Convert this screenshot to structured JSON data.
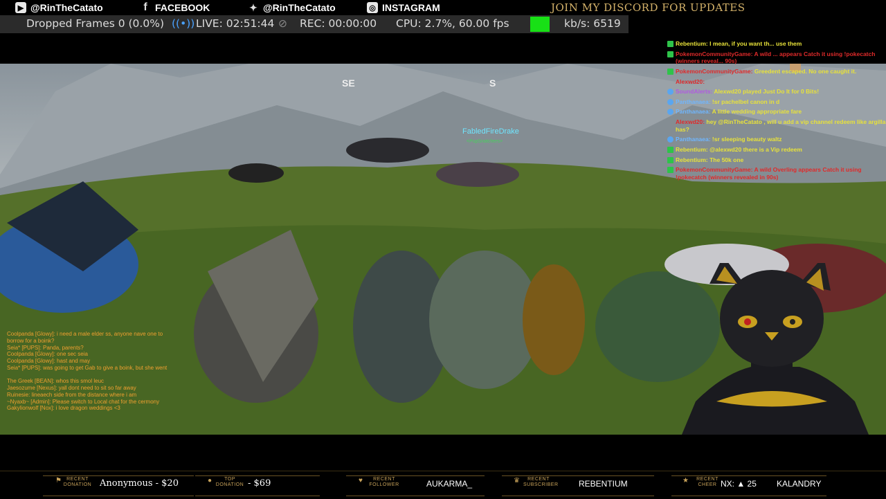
{
  "social": {
    "youtube": "@RinTheCatato",
    "facebook": "FACEBOOK",
    "twitter": "@RinTheCatato",
    "instagram": "INSTAGRAM",
    "discord": "JOIN MY DISCORD FOR UPDATES"
  },
  "obs": {
    "dropped": "Dropped Frames 0 (0.0%)",
    "live": "LIVE: 02:51:44",
    "rec": "REC: 00:00:00",
    "cpu": "CPU: 2.7%, 60.00 fps",
    "kbs": "kb/s: 6519"
  },
  "game": {
    "compass": [
      "SE",
      "S"
    ],
    "nameplate": "FabledFireDrake",
    "nameplate_tag": "<PupSnatchers>"
  },
  "chat_right": [
    {
      "user": "Rebentium:",
      "user_color": "#e8e23a",
      "msg": "I mean, if you want th... use them",
      "msg_color": "#e8e23a",
      "badge": "check"
    },
    {
      "user": "PokemonCommunityGame:",
      "user_color": "#e02a2a",
      "msg": "A wild ... appears Catch it using !pokecatch (winners reveal... 90s)",
      "msg_color": "#e02a2a",
      "badge": "check"
    },
    {
      "user": "PokemonCommunityGame:",
      "user_color": "#e02a2a",
      "msg": "Greedent escaped. No one caught it.",
      "msg_color": "#e8e23a",
      "badge": "check"
    },
    {
      "user": "Alexwd20:",
      "user_color": "#e02a2a",
      "msg": "",
      "msg_color": "#e8e23a",
      "badge": "none"
    },
    {
      "user": "SoundAlerts:",
      "user_color": "#b05ae0",
      "msg": "Alexwd20 played Just Do It for 0 Bits!",
      "msg_color": "#e8e23a",
      "badge": "blue"
    },
    {
      "user": "Panthanaea:",
      "user_color": "#6fb6ff",
      "msg": "!sr pachelbel canon in d",
      "msg_color": "#e8e23a",
      "badge": "blue"
    },
    {
      "user": "Panthanaea:",
      "user_color": "#6fb6ff",
      "msg": "A little wedding appropriate fare",
      "msg_color": "#e8e23a",
      "badge": "blue"
    },
    {
      "user": "Alexwd20:",
      "user_color": "#e02a2a",
      "msg": "hey @RinTheCatato , will u add a vip channel redeem like argilla has?",
      "msg_color": "#e8e23a",
      "badge": "none"
    },
    {
      "user": "Panthanaea:",
      "user_color": "#6fb6ff",
      "msg": "!sr sleeping beauty waltz",
      "msg_color": "#e8e23a",
      "badge": "blue"
    },
    {
      "user": "Rebentium:",
      "user_color": "#e8e23a",
      "msg": "@alexwd20 there is a Vip redeem",
      "msg_color": "#e8e23a",
      "badge": "check"
    },
    {
      "user": "Rebentium:",
      "user_color": "#e8e23a",
      "msg": "The 50k one",
      "msg_color": "#e8e23a",
      "badge": "check"
    },
    {
      "user": "PokemonCommunityGame:",
      "user_color": "#e02a2a",
      "msg": "A wild Overling appears Catch it using !pokecatch (winners revealed in 90s)",
      "msg_color": "#e02a2a",
      "badge": "check"
    }
  ],
  "chat_left": [
    "Coolpanda [Glowy]: i need a male elder ss, anyone nave one to",
    "borrow for a boink?",
    "Seia* [PUPS]: Panda, parents?",
    "Coolpanda [Glowy]: one sec seia",
    "Coolpanda [Glowy]: hast and may",
    "Seia* [PUPS]: was going to get Gab to give a boink, but she went",
    "",
    "The Greek [BEAN]: whos this smol leuc",
    "Jaesozume [Nexus]: yall dont need to sit so far away",
    "Ruinesie: lineaech side from the distance where i am",
    "~Nyaxb~ [Admin]: Please switch to Local chat for the cermony",
    "Gakylionwolf [Nox]: i love dragon weddings <3"
  ],
  "bottom": {
    "recent_donation_label": "RECENT DONATION",
    "recent_donation": "Anonymous - $20",
    "top_donation_label": "TOP DONATION",
    "top_donation": "- $69",
    "recent_follower_label": "RECENT FOLLOWER",
    "recent_follower": "AUKARMA_",
    "recent_subscriber_label": "RECENT SUBSCRIBER",
    "recent_subscriber": "REBENTIUM",
    "recent_cheer_label": "RECENT CHEER",
    "recent_cheer": "NX: ▲ 25",
    "recent_cheer_user": "KALANDRY"
  },
  "colors": {
    "accent_gold": "#c9a35a",
    "obs_live_green": "#18e016"
  }
}
